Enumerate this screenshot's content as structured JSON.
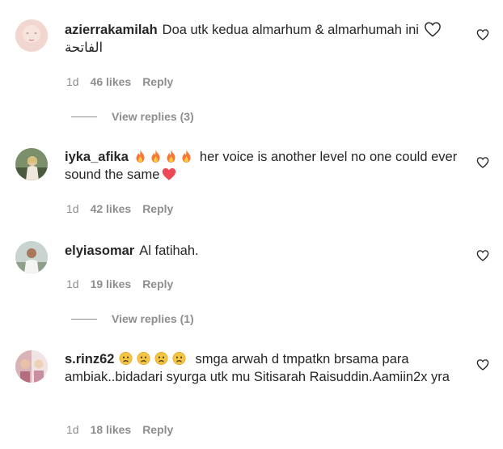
{
  "comments": [
    {
      "username": "azierrakamilah",
      "text": "Doa utk kedua almarhum & almarhumah ini",
      "text_line2": "الفاتحة",
      "emoji_after": "white-heart-outline",
      "age": "1d",
      "likes": "46 likes",
      "reply": "Reply",
      "view_replies": "View replies (3)"
    },
    {
      "username": "iyka_afika",
      "emoji_before": [
        "fire",
        "fire",
        "fire",
        "fire"
      ],
      "text": "her voice is another level no one could ever sound the same",
      "emoji_after": "red-heart",
      "age": "1d",
      "likes": "42 likes",
      "reply": "Reply"
    },
    {
      "username": "elyiasomar",
      "text": "Al fatihah.",
      "age": "1d",
      "likes": "19 likes",
      "reply": "Reply",
      "view_replies": "View replies (1)"
    },
    {
      "username": "s.rinz62",
      "emoji_before": [
        "sad-face",
        "sad-face",
        "sad-face",
        "sad-face"
      ],
      "text": "smga arwah d tmpatkn brsama para ambiak..bidadari syurga utk mu Sitisarah Raisuddin.Aamiin2x yra",
      "age": "1d",
      "likes": "18 likes",
      "reply": "Reply"
    }
  ],
  "colors": {
    "text": "#262626",
    "muted": "#8e8e8e",
    "fire": "#f77737",
    "red_heart": "#ed4956"
  }
}
